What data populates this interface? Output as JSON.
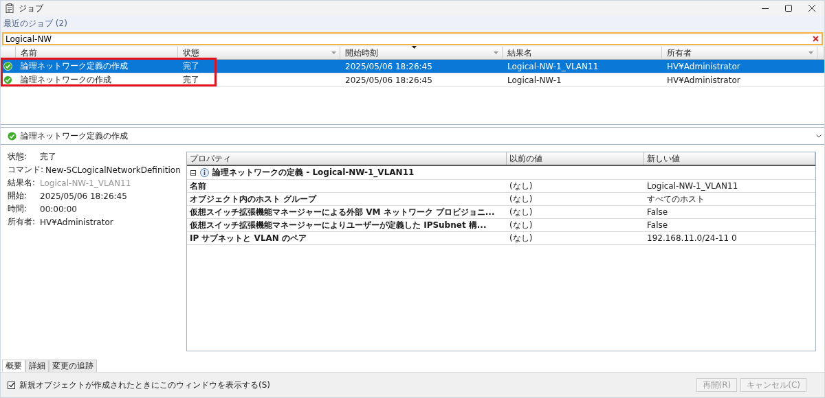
{
  "window": {
    "title": "ジョブ"
  },
  "section_label": "最近のジョブ (2)",
  "search": {
    "value": "Logical-NW"
  },
  "jobs_table": {
    "columns": [
      {
        "label": "名前",
        "sorted": false,
        "filter": false
      },
      {
        "label": "状態",
        "sorted": false,
        "filter": true
      },
      {
        "label": "開始時刻",
        "sorted": true,
        "filter": true
      },
      {
        "label": "結果名",
        "sorted": false,
        "filter": false
      },
      {
        "label": "所有者",
        "sorted": false,
        "filter": true
      }
    ],
    "rows": [
      {
        "selected": true,
        "cells": [
          "論理ネットワーク定義の作成",
          "完了",
          "2025/05/06 18:26:45",
          "Logical-NW-1_VLAN11",
          "HV¥Administrator"
        ]
      },
      {
        "selected": false,
        "cells": [
          "論理ネットワークの作成",
          "完了",
          "2025/05/06 18:26:45",
          "Logical-NW-1",
          "HV¥Administrator"
        ]
      }
    ]
  },
  "detail": {
    "title": "論理ネットワーク定義の作成",
    "summary": [
      {
        "label": "状態:",
        "value": "完了",
        "dimmed": false
      },
      {
        "label": "コマンド:",
        "value": "New-SCLogicalNetworkDefinition",
        "dimmed": false
      },
      {
        "label": "結果名:",
        "value": "Logical-NW-1_VLAN11",
        "dimmed": true
      },
      {
        "label": "開始:",
        "value": "2025/05/06 18:26:45",
        "dimmed": false
      },
      {
        "label": "時間:",
        "value": "00:00:00",
        "dimmed": false
      },
      {
        "label": "所有者:",
        "value": "HV¥Administrator",
        "dimmed": false
      }
    ],
    "properties": {
      "columns": [
        "プロパティ",
        "以前の値",
        "新しい値"
      ],
      "group": {
        "expander": "⊟",
        "expanded": true,
        "title": "論理ネットワークの定義 - Logical-NW-1_VLAN11"
      },
      "rows": [
        {
          "name": "名前",
          "old": "(なし)",
          "new": "Logical-NW-1_VLAN11"
        },
        {
          "name": "オブジェクト内のホスト グループ",
          "old": "(なし)",
          "new": "すべてのホスト"
        },
        {
          "name": "仮想スイッチ拡張機能マネージャーによる外部 VM ネットワーク プロビジョニ...",
          "old": "(なし)",
          "new": "False"
        },
        {
          "name": "仮想スイッチ拡張機能マネージャーによりユーザーが定義した IPSubnet 構...",
          "old": "(なし)",
          "new": "False"
        },
        {
          "name": "IP サブネットと VLAN のペア",
          "old": "(なし)",
          "new": "192.168.11.0/24-11 0"
        }
      ]
    }
  },
  "tabs": [
    {
      "label": "概要",
      "selected": true
    },
    {
      "label": "詳細",
      "selected": false
    },
    {
      "label": "変更の追跡",
      "selected": false
    }
  ],
  "footer": {
    "checkbox": {
      "label": "新規オブジェクトが作成されたときにこのウィンドウを表示する(S)",
      "checked": true
    },
    "buttons": [
      {
        "label": "再開(R)",
        "disabled": true
      },
      {
        "label": "キャンセル(C)",
        "disabled": true
      }
    ]
  }
}
